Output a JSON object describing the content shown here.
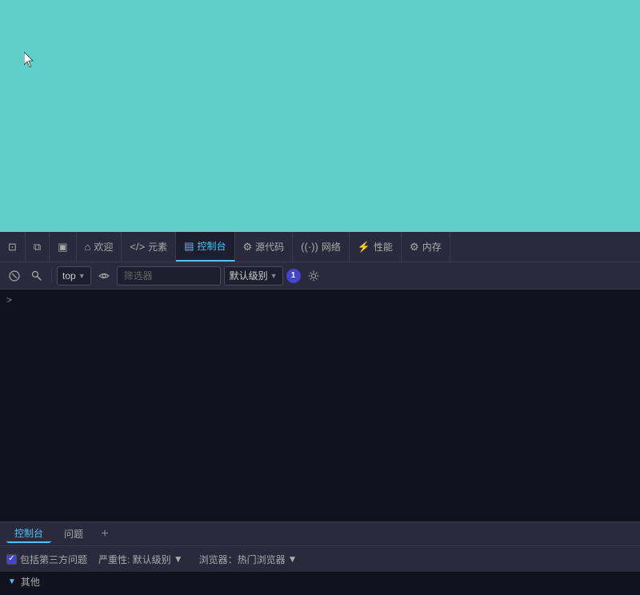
{
  "browser": {
    "bg_color": "#5fcfca"
  },
  "devtools": {
    "tabs": [
      {
        "id": "inspect",
        "icon": "⊡",
        "label": "",
        "active": false
      },
      {
        "id": "copy",
        "icon": "⧉",
        "label": "",
        "active": false
      },
      {
        "id": "sidebar",
        "icon": "▣",
        "label": "",
        "active": false
      },
      {
        "id": "welcome",
        "icon": "⌂",
        "label": "欢迎",
        "active": false
      },
      {
        "id": "elements",
        "icon": "</>",
        "label": "元素",
        "active": false
      },
      {
        "id": "console",
        "icon": "▤",
        "label": "控制台",
        "active": true
      },
      {
        "id": "sources",
        "icon": "✦",
        "label": "源代码",
        "active": false
      },
      {
        "id": "network",
        "icon": "((·))",
        "label": "网络",
        "active": false
      },
      {
        "id": "performance",
        "icon": "⚡",
        "label": "性能",
        "active": false
      },
      {
        "id": "settings",
        "icon": "⚙",
        "label": "内存",
        "active": false
      }
    ],
    "toolbar": {
      "context_value": "top",
      "filter_placeholder": "筛选器",
      "level_label": "默认级别",
      "issues_count": "1"
    },
    "console": {
      "prompt_symbol": ">"
    },
    "status_tabs": [
      {
        "label": "控制台",
        "active": true
      },
      {
        "label": "问题",
        "active": false
      }
    ],
    "add_tab_label": "+",
    "issues": {
      "checkbox_label": "包括第三方问题",
      "severity_label": "严重性: 默认级别",
      "browser_label": "浏览器：热门浏览器",
      "group_label": "其他",
      "severity_arrow": "▼",
      "browser_arrow": "▼",
      "group_arrow": "▼"
    }
  }
}
